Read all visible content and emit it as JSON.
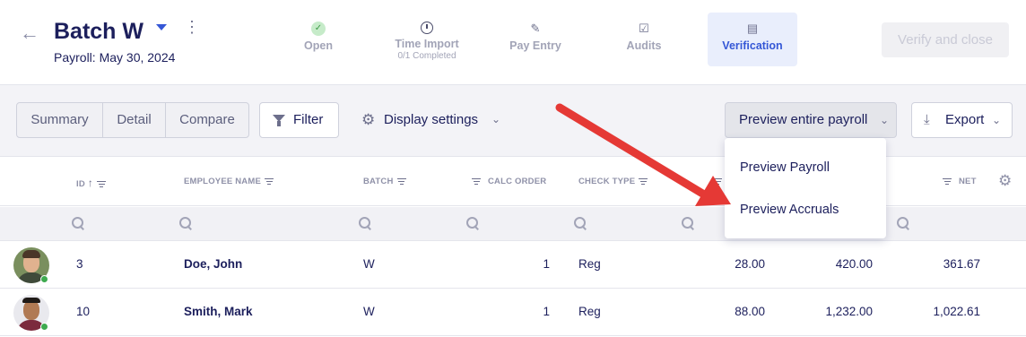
{
  "header": {
    "title": "Batch W",
    "subtitle": "Payroll: May 30, 2024",
    "verify_label": "Verify and close"
  },
  "steps": [
    {
      "label": "Open",
      "sub": "",
      "icon": "check-circle-icon",
      "state": "done"
    },
    {
      "label": "Time Import",
      "sub": "0/1 Completed",
      "icon": "clock-icon",
      "state": "pending"
    },
    {
      "label": "Pay Entry",
      "sub": "",
      "icon": "pen-icon",
      "state": "pending"
    },
    {
      "label": "Audits",
      "sub": "",
      "icon": "clipboard-check-icon",
      "state": "pending"
    },
    {
      "label": "Verification",
      "sub": "",
      "icon": "document-icon",
      "state": "active"
    }
  ],
  "toolbar": {
    "views": [
      "Summary",
      "Detail",
      "Compare"
    ],
    "filter_label": "Filter",
    "display_settings_label": "Display settings",
    "preview_label": "Preview entire payroll",
    "export_label": "Export"
  },
  "dropdown": {
    "items": [
      "Preview Payroll",
      "Preview Accruals"
    ]
  },
  "table": {
    "columns": [
      "ID",
      "EMPLOYEE NAME",
      "BATCH",
      "CALC ORDER",
      "CHECK TYPE",
      "NET"
    ],
    "rows": [
      {
        "id": "3",
        "name": "Doe, John",
        "batch": "W",
        "calc_order": "1",
        "check_type": "Reg",
        "hours": "28.00",
        "gross": "420.00",
        "net": "361.67"
      },
      {
        "id": "10",
        "name": "Smith, Mark",
        "batch": "W",
        "calc_order": "1",
        "check_type": "Reg",
        "hours": "88.00",
        "gross": "1,232.00",
        "net": "1,022.61"
      }
    ]
  },
  "colors": {
    "accent": "#3557d6",
    "annotation_arrow": "#e53935",
    "online": "#3eaa4f"
  }
}
